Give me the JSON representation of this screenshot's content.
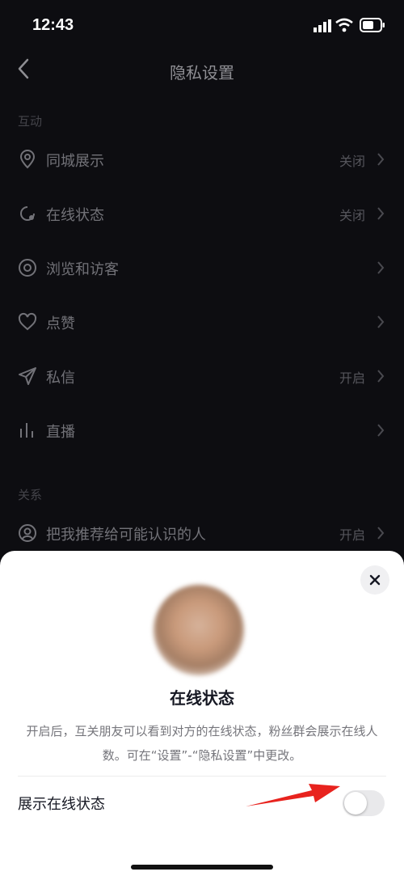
{
  "status": {
    "time": "12:43"
  },
  "header": {
    "title": "隐私设置"
  },
  "sections": {
    "interaction": "互动",
    "relations": "关系"
  },
  "rows": [
    {
      "label": "同城展示",
      "value": "关闭",
      "icon": "location-icon"
    },
    {
      "label": "在线状态",
      "value": "关闭",
      "icon": "online-status-icon"
    },
    {
      "label": "浏览和访客",
      "value": "",
      "icon": "eye-icon"
    },
    {
      "label": "点赞",
      "value": "",
      "icon": "heart-icon"
    },
    {
      "label": "私信",
      "value": "开启",
      "icon": "send-icon"
    },
    {
      "label": "直播",
      "value": "",
      "icon": "live-bars-icon"
    },
    {
      "label": "把我推荐给可能认识的人",
      "value": "开启",
      "icon": "user-circle-icon"
    }
  ],
  "sheet": {
    "title": "在线状态",
    "description": "开启后，互关朋友可以看到对方的在线状态，粉丝群会展示在线人数。可在“设置”-“隐私设置”中更改。",
    "toggle_label": "展示在线状态",
    "toggle_on": false
  },
  "colors": {
    "background": "#0d0d11",
    "sheet": "#ffffff",
    "arrow": "#e8231e"
  }
}
